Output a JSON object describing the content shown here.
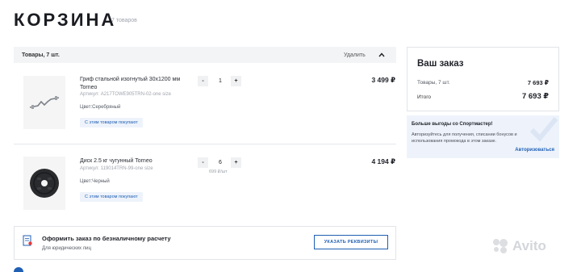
{
  "page": {
    "title": "КОРЗИНА",
    "count": "7 товаров"
  },
  "cart_header": {
    "label": "Товары, 7 шт.",
    "delete": "Удалить"
  },
  "items": [
    {
      "name": "Гриф стальной изогнутый 30х1200 мм Torneo",
      "sku": "Артикул: A217TOWE905TRN-02-one size",
      "color": "Цвет:Серебряный",
      "tag": "С этим товаром покупают",
      "minus": "-",
      "qty": "1",
      "plus": "+",
      "price": "3 499 ₽"
    },
    {
      "name": "Диск 2.5 кг чугунный Torneo",
      "sku": "Артикул: 119014TRN-99-one size",
      "color": "Цвет:Черный",
      "tag": "С этим товаром покупают",
      "minus": "-",
      "qty": "6",
      "plus": "+",
      "unit_price": "699 ₽/шт",
      "price": "4 194 ₽"
    }
  ],
  "summary": {
    "heading": "Ваш заказ",
    "items_label": "Товары, 7 шт.",
    "items_value": "7 693 ₽",
    "total_label": "Итого",
    "total_value": "7 693 ₽"
  },
  "promo": {
    "title": "Больше выгоды со Спортмастер!",
    "text": "Авторизуйтесь для получения, списании бонусов и использования промокода в этом заказе.",
    "action": "Авторизоваться"
  },
  "invoice": {
    "title": "Оформить заказ по безналичному расчету",
    "subtitle": "Для юридических лиц",
    "button": "УКАЗАТЬ РЕКВИЗИТЫ"
  },
  "watermark": {
    "text": "Avito"
  },
  "colors": {
    "accent": "#1f5fb4",
    "header_bg": "#f2f4f6",
    "promo_bg": "#eef3fb"
  }
}
